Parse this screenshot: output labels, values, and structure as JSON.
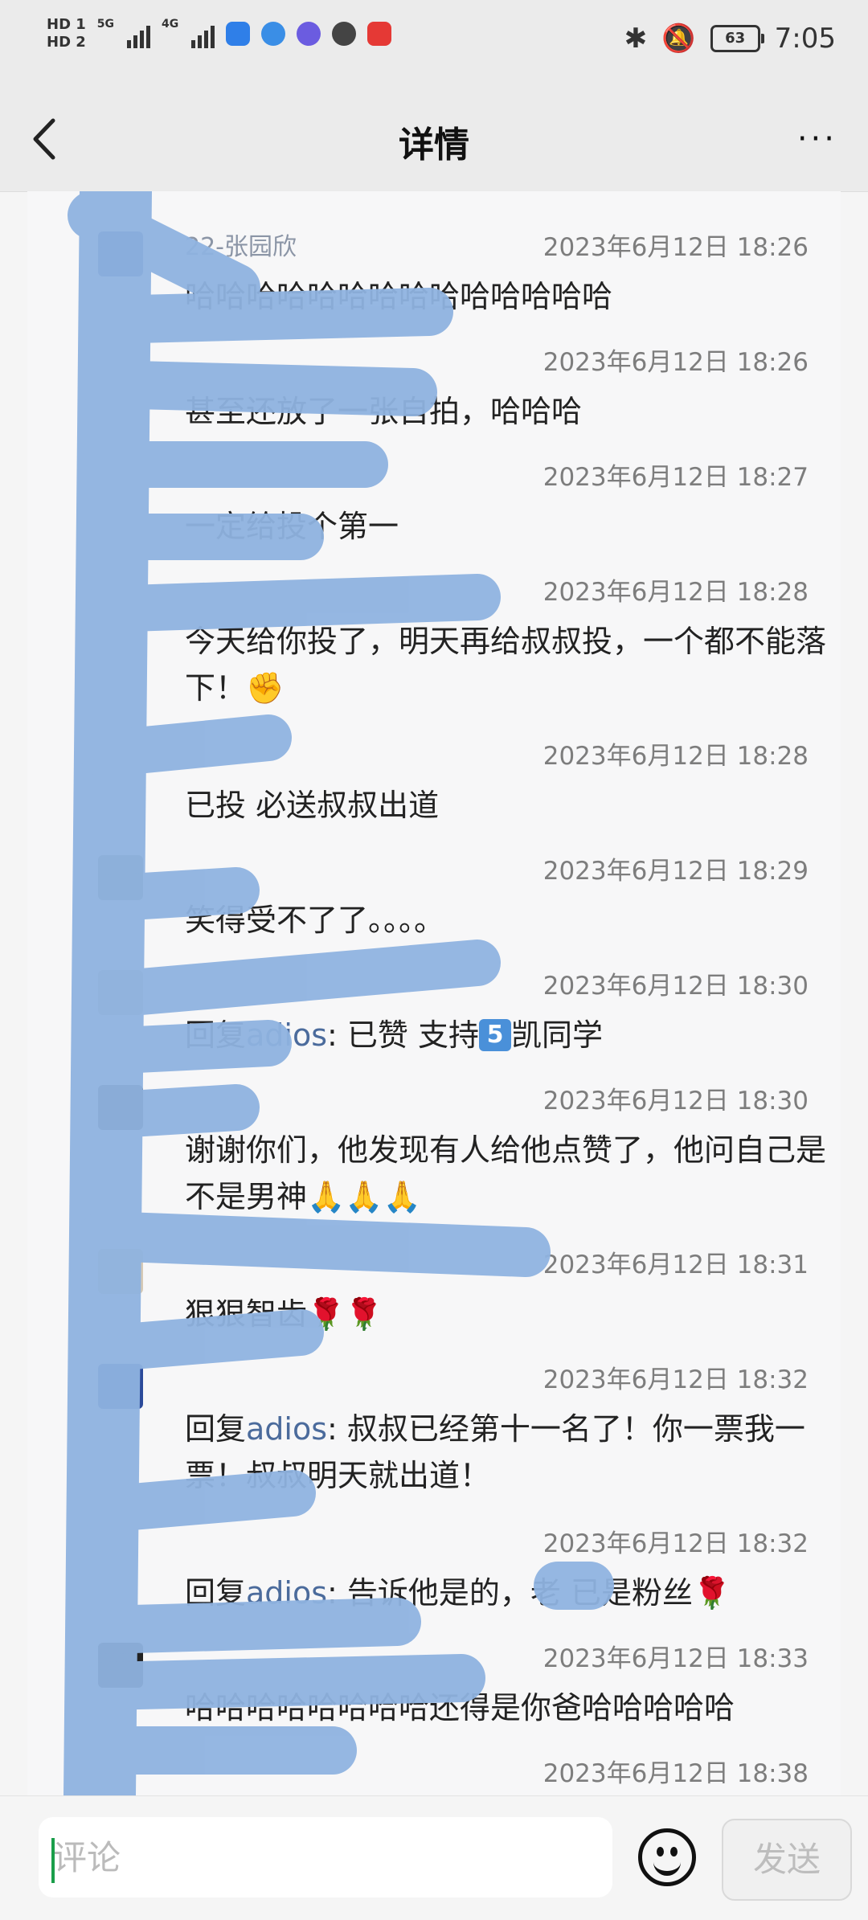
{
  "status_bar": {
    "sim1": "HD 1",
    "sim2": "HD 2",
    "net1": "5G",
    "net2": "4G",
    "battery": "63",
    "time": "7:05"
  },
  "header": {
    "title": "详情",
    "more": "···"
  },
  "comments": [
    {
      "name": "22-张园欣",
      "time": "2023年6月12日 18:26",
      "text": "哈哈哈哈哈哈哈哈哈哈哈哈哈哈"
    },
    {
      "name": "",
      "time": "2023年6月12日 18:26",
      "text": "甚至还放了一张自拍，哈哈哈"
    },
    {
      "name": "",
      "time": "2023年6月12日 18:27",
      "text": "一定给投个第一"
    },
    {
      "name": "",
      "time": "2023年6月12日 18:28",
      "text": "今天给你投了，明天再给叔叔投，一个都不能落下！✊"
    },
    {
      "name": "",
      "time": "2023年6月12日 18:28",
      "text": "已投 必送叔叔出道"
    },
    {
      "name": "",
      "time": "2023年6月12日 18:29",
      "text": "笑得受不了了。。。。"
    },
    {
      "name": "",
      "time": "2023年6月12日 18:30",
      "reply_prefix": "回复",
      "reply_to": "adios",
      "text": ": 已赞 支持",
      "box": "5",
      "text_after": "凯同学"
    },
    {
      "name": "",
      "time": "2023年6月12日 18:30",
      "text": "谢谢你们，他发现有人给他点赞了，他问自己是不是男神🙏🙏🙏"
    },
    {
      "name": "",
      "time": "2023年6月12日 18:31",
      "text": "狠狠智齿🌹🌹"
    },
    {
      "name": "",
      "time": "2023年6月12日 18:32",
      "reply_prefix": "回复",
      "reply_to": "adios",
      "text": ": 叔叔已经第十一名了！你一票我一票！叔叔明天就出道！"
    },
    {
      "name": "",
      "time": "2023年6月12日 18:32",
      "reply_prefix": "回复",
      "reply_to": "adios",
      "text": ": 告诉他是的，老       已是粉丝🌹"
    },
    {
      "name": "",
      "time": "2023年6月12日 18:33",
      "text": "哈哈哈哈哈哈哈哈还得是你爸哈哈哈哈哈"
    },
    {
      "name": "",
      "time": "2023年6月12日 18:38",
      "text": ""
    }
  ],
  "input": {
    "placeholder": "评论",
    "send_label": "发送"
  },
  "colors": {
    "accent_link": "#4b6b9c",
    "scribble": "#8fb3e0"
  }
}
